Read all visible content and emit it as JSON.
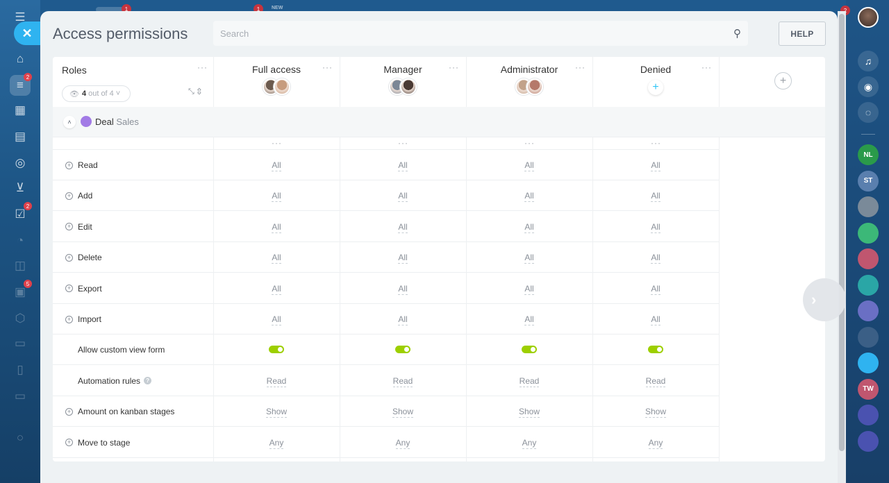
{
  "panel": {
    "title": "Access permissions",
    "search_placeholder": "Search",
    "help_label": "HELP"
  },
  "top_strip": {
    "badge_1": "1",
    "badge_2": "1",
    "new_label": "NEW"
  },
  "left_bar": {
    "badges": [
      "2",
      "2",
      "5"
    ]
  },
  "right_bar": {
    "top_badge": "2",
    "avatars": [
      {
        "initials": "NL",
        "color": "#2a9a4a"
      },
      {
        "initials": "ST",
        "color": "#5a7fae"
      },
      {
        "initials": "",
        "color": "#7a8a99"
      },
      {
        "initials": "",
        "color": "#3cb878"
      },
      {
        "initials": "",
        "color": "#c0566f"
      },
      {
        "initials": "",
        "color": "#2aa6a6"
      },
      {
        "initials": "",
        "color": "#6a6fc4"
      },
      {
        "initials": "",
        "color": "#3b5f86"
      },
      {
        "initials": "",
        "color": "#2fb3f0"
      },
      {
        "initials": "TW",
        "color": "#c0566f"
      },
      {
        "initials": "",
        "color": "#4a52b0"
      },
      {
        "initials": "",
        "color": "#4a52b0"
      }
    ]
  },
  "table": {
    "roles_title": "Roles",
    "counter": {
      "count": "4",
      "suffix": "out of 4"
    },
    "roles": [
      {
        "name": "Full access",
        "avatars": [
          "#6b5a4e",
          "#c79c7e"
        ]
      },
      {
        "name": "Manager",
        "avatars": [
          "#7c8796",
          "#4a3a34"
        ]
      },
      {
        "name": "Administrator",
        "avatars": [
          "#c2a28a",
          "#b5796a"
        ]
      },
      {
        "name": "Denied",
        "avatars": []
      }
    ],
    "group": {
      "entity": "Deal",
      "pipeline": "Sales"
    },
    "rows": [
      {
        "name": "Read",
        "expandable": true,
        "info": false,
        "type": "text",
        "values": [
          "All",
          "All",
          "All",
          "All"
        ]
      },
      {
        "name": "Add",
        "expandable": true,
        "info": false,
        "type": "text",
        "values": [
          "All",
          "All",
          "All",
          "All"
        ]
      },
      {
        "name": "Edit",
        "expandable": true,
        "info": false,
        "type": "text",
        "values": [
          "All",
          "All",
          "All",
          "All"
        ]
      },
      {
        "name": "Delete",
        "expandable": true,
        "info": false,
        "type": "text",
        "values": [
          "All",
          "All",
          "All",
          "All"
        ]
      },
      {
        "name": "Export",
        "expandable": true,
        "info": false,
        "type": "text",
        "values": [
          "All",
          "All",
          "All",
          "All"
        ]
      },
      {
        "name": "Import",
        "expandable": true,
        "info": false,
        "type": "text",
        "values": [
          "All",
          "All",
          "All",
          "All"
        ]
      },
      {
        "name": "Allow custom view form",
        "expandable": false,
        "info": false,
        "type": "toggle",
        "values": [
          "on",
          "on",
          "on",
          "on"
        ]
      },
      {
        "name": "Automation rules",
        "expandable": false,
        "info": true,
        "type": "text",
        "values": [
          "Read",
          "Read",
          "Read",
          "Read"
        ]
      },
      {
        "name": "Amount on kanban stages",
        "expandable": true,
        "info": false,
        "type": "text",
        "values": [
          "Show",
          "Show",
          "Show",
          "Show"
        ]
      },
      {
        "name": "Move to stage",
        "expandable": true,
        "info": false,
        "type": "text",
        "values": [
          "Any",
          "Any",
          "Any",
          "Any"
        ]
      }
    ]
  },
  "colors": {
    "accent": "#2fc6f6",
    "toggle_on": "#9dcf00",
    "close_button": "#2fb3f0"
  }
}
